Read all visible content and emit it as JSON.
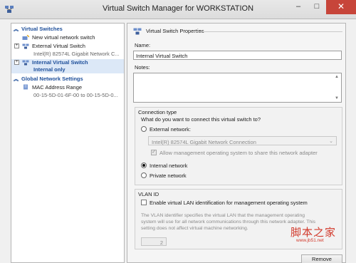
{
  "window": {
    "title": "Virtual Switch Manager for WORKSTATION",
    "minimize": "–",
    "maximize": "□",
    "close": "✕"
  },
  "sidebar": {
    "virtual_switches_header": "Virtual Switches",
    "items": [
      {
        "label": "New virtual network switch"
      },
      {
        "label": "External Virtual Switch",
        "sub": "Intel(R) 82574L Gigabit Network C..."
      },
      {
        "label": "Internal Virtual Switch",
        "sub": "Internal only"
      }
    ],
    "global_header": "Global Network Settings",
    "mac": {
      "label": "MAC Address Range",
      "sub": "00-15-5D-01-6F-00 to 00-15-5D-0..."
    }
  },
  "properties": {
    "title": "Virtual Switch Properties",
    "name_label": "Name:",
    "name_value": "Internal Virtual Switch",
    "notes_label": "Notes:",
    "notes_value": "",
    "connection": {
      "group_title": "Connection type",
      "question": "What do you want to connect this virtual switch to?",
      "external": "External network:",
      "adapter": "Intel(R) 82574L Gigabit Network Connection",
      "allow_mgmt": "Allow management operating system to share this network adapter",
      "internal": "Internal network",
      "private": "Private network",
      "selected": "internal"
    },
    "vlan": {
      "group_title": "VLAN ID",
      "enable": "Enable virtual LAN identification for management operating system",
      "desc1": "The VLAN identifier specifies the virtual LAN that the management operating",
      "desc2": "system will use for all network communications through this network adapter. This",
      "desc3": "setting does not affect virtual machine networking.",
      "value": "2"
    },
    "remove": "Remove"
  },
  "watermark": {
    "main": "脚本之家",
    "url": "www.jb51.net"
  }
}
